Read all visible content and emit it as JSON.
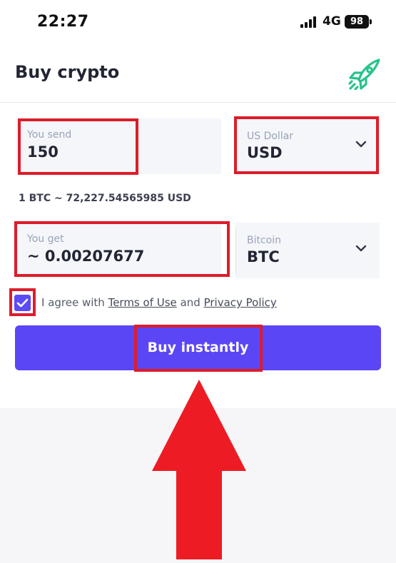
{
  "status_bar": {
    "time": "22:27",
    "network": "4G",
    "battery": "98"
  },
  "header": {
    "title": "Buy crypto",
    "logo_icon": "rocket-icon"
  },
  "send": {
    "label": "You send",
    "value": "150"
  },
  "currency": {
    "label": "US Dollar",
    "value": "USD"
  },
  "rate": "1 BTC ~ 72,227.54565985 USD",
  "get": {
    "label": "You get",
    "value": "~ 0.00207677"
  },
  "coin": {
    "label": "Bitcoin",
    "value": "BTC"
  },
  "agreement": {
    "checked": true,
    "prefix": "I agree with",
    "terms_link": "Terms of Use",
    "conjunction": "and",
    "privacy_link": "Privacy Policy"
  },
  "buy_button": {
    "label": "Buy instantly"
  },
  "colors": {
    "accent": "#5b46f6",
    "logo": "#27c48a",
    "highlight": "#dd1c2a",
    "field_bg": "#f4f6fa"
  }
}
